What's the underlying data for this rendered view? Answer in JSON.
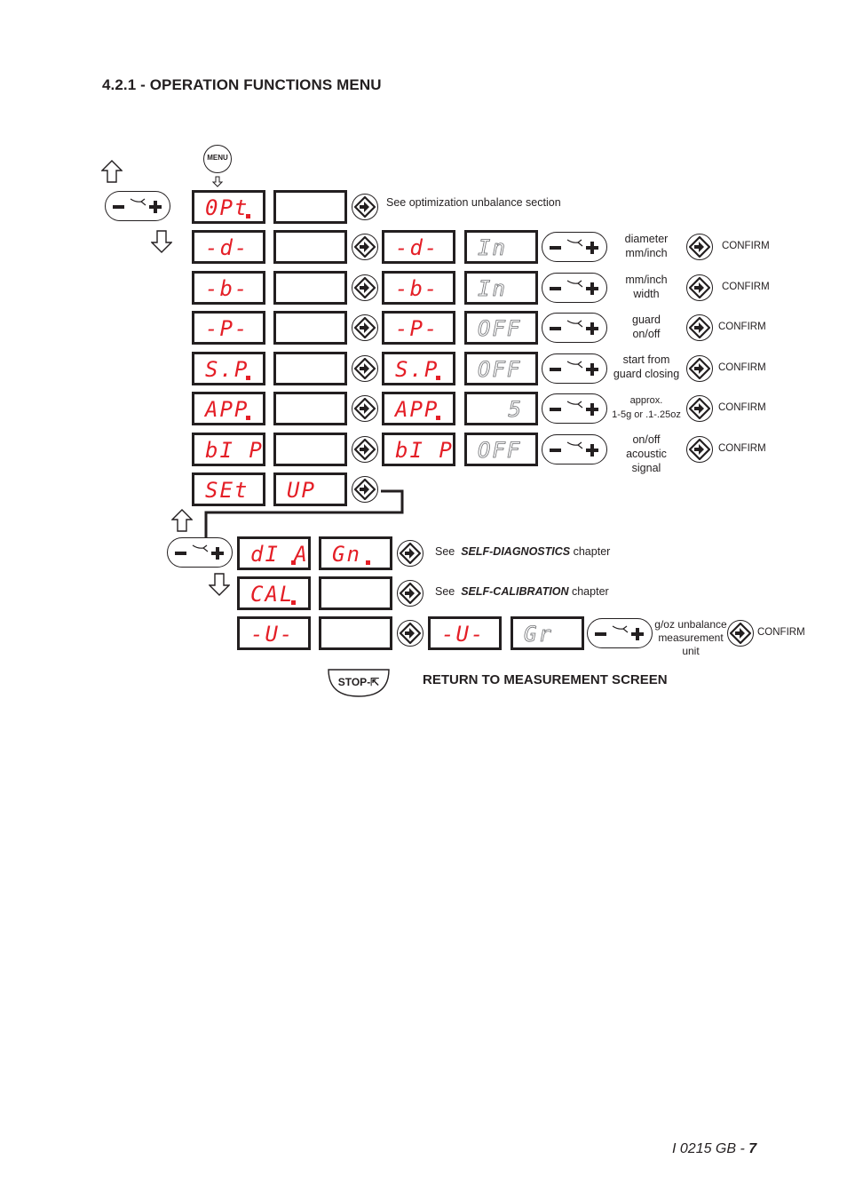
{
  "title": "4.2.1 - OPERATION FUNCTIONS MENU",
  "menu_button_label": "MENU",
  "stop_button_label": "STOP-⇱",
  "return_text": "RETURN TO  MEASUREMENT SCREEN",
  "footer": {
    "doc": "I 0215 GB",
    "sep": " - ",
    "page": "7"
  },
  "confirm_label": "CONFIRM",
  "colors": {
    "display_red": "#e41e26",
    "ink": "#231f20"
  },
  "main_menu": [
    {
      "code": "0Pt",
      "dot": true,
      "note": "See optimization unbalance section"
    },
    {
      "code": "-d-",
      "sub_code": "-d-",
      "value": "In",
      "label": [
        "diameter",
        "mm/inch"
      ],
      "confirm": "CONFIRM"
    },
    {
      "code": "-b-",
      "sub_code": "-b-",
      "value": "In",
      "label": [
        "mm/inch",
        "width"
      ],
      "confirm": "CONFIRM"
    },
    {
      "code": "-P-",
      "sub_code": "-P-",
      "value": "OFF",
      "label": [
        "guard",
        "on/off"
      ],
      "confirm": "CONFIRM"
    },
    {
      "code": "S.P",
      "dot": true,
      "sub_code": "S.P",
      "value": "OFF",
      "label": [
        "start from",
        "guard closing"
      ],
      "confirm": "CONFIRM"
    },
    {
      "code": "APP",
      "dot": true,
      "sub_code": "APP",
      "value": "5",
      "label": [
        "approx.",
        "1-5g or .1-.25oz"
      ],
      "confirm": "CONFIRM"
    },
    {
      "code": "bI P",
      "sub_code": "bI P",
      "value": "OFF",
      "label": [
        "on/off",
        "acoustic",
        "signal"
      ],
      "confirm": "CONFIRM"
    },
    {
      "code": "SEt",
      "code2": "UP"
    }
  ],
  "setup_menu": [
    {
      "code": "dI A",
      "dot": true,
      "code2": "Gn",
      "dot2": true,
      "note_prefix": "See",
      "note_bold": "SELF-DIAGNOSTICS",
      "note_suffix": "chapter"
    },
    {
      "code": "CAL",
      "dot": true,
      "note_prefix": "See",
      "note_bold": "SELF-CALIBRATION",
      "note_suffix": "chapter"
    },
    {
      "code": "-U-",
      "sub_code": "-U-",
      "value": "Gr",
      "label": [
        "g/oz unbalance",
        "measurement",
        "unit"
      ],
      "confirm": "CONFIRM"
    }
  ]
}
